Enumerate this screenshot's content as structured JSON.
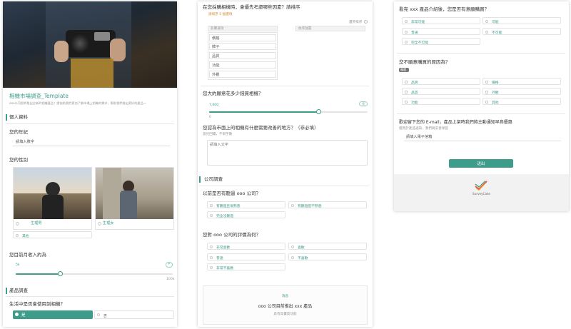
{
  "colors": {
    "accent": "#3d9c8a",
    "accent_light": "#e8f4f1",
    "border": "#e3e3e3",
    "text": "#333333"
  },
  "panel1": {
    "title": "相機市場調查_Template",
    "intro": "ooo公司即將推出全新的相機產品！請協助我們更加了解市場上相機的需求，幫助我們推出更好的產品～",
    "section_personal": "個人資料",
    "age_label": "您的年紀",
    "age_placeholder": "請填入數字",
    "gender_label": "您的性別",
    "gender_options": [
      "生理男",
      "生理女",
      "其他"
    ],
    "income_label": "您目前月收入約為",
    "income_value": "5k",
    "income_max": "100k",
    "section_product": "產品調查",
    "use_camera_label": "生活中是否會使用到相機？",
    "yes_label": "是",
    "no_label": "否"
  },
  "panel2": {
    "rank_q": "在您採購相機時，會優先考慮哪些因素？請排序",
    "rank_hint": "請排序 5 個選項",
    "rank_reset": "還原排序",
    "rank_left_header": "影響選項",
    "rank_right_header": "依序放置",
    "rank_items": [
      "價格",
      "牌子",
      "品質",
      "功能",
      "外觀"
    ],
    "budget_q": "您大約願意花多少錢買相機？",
    "budget_value": "7,000",
    "budget_min": "0",
    "budget_badge": "元",
    "improve_q": "您認為市面上的相機有什麼需要改善的地方？（非必填）",
    "improve_hint": "意見回饋，不限字數",
    "improve_placeholder": "請填入文字",
    "section_company": "公司調查",
    "heard_q": "以前是否有聽過 ooo 公司？",
    "heard_options": [
      "有聽過且很熟悉",
      "有聽過但不熟悉",
      "完全沒聽過"
    ],
    "rating_q": "您對 ooo 公司的評價為何？",
    "rating_options": [
      "非常喜歡",
      "喜歡",
      "普通",
      "不喜歡",
      "非常不喜歡"
    ],
    "card_tag": "消息",
    "card_title": "ooo 公司目前推出 xxx 產品",
    "card_sub": "具有高畫質功能"
  },
  "panel3": {
    "buy_q": "看完 xxx 產品介紹後，您是否有意願購買？",
    "buy_options": [
      "非常可能",
      "可能",
      "普通",
      "不可能",
      "完全不可能"
    ],
    "reason_q": "您不願意購買的原因為？",
    "reason_tag": "複選",
    "reason_options": [
      "品牌",
      "價格",
      "品質",
      "外觀",
      "功能",
      "其他"
    ],
    "email_q": "歡迎留下您的 E-mail，產品上架時我們將主動通知早鳥優惠",
    "email_hint": "僅用於產品通知，我們將妥善保管",
    "email_placeholder": "請填入電子信箱",
    "submit_label": "送出",
    "brand_name": "SurveyCake"
  }
}
